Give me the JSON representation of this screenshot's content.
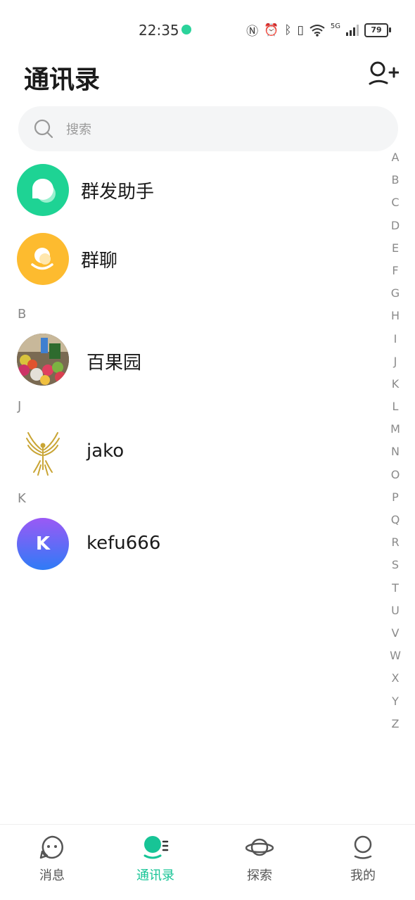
{
  "status_bar": {
    "time": "22:35",
    "battery": "79",
    "network": "5G"
  },
  "header": {
    "title": "通讯录"
  },
  "search": {
    "placeholder": "搜索"
  },
  "functions": [
    {
      "label": "群发助手",
      "color": "#1ed394",
      "icon": "chat-bubble-icon"
    },
    {
      "label": "群聊",
      "color": "#fdbb2f",
      "icon": "group-icon"
    }
  ],
  "sections": [
    {
      "letter": "B",
      "contacts": [
        {
          "name": "百果园",
          "avatar": "fruit-store-photo"
        }
      ]
    },
    {
      "letter": "J",
      "contacts": [
        {
          "name": "jako",
          "avatar": "golden-eagle-logo"
        }
      ]
    },
    {
      "letter": "K",
      "contacts": [
        {
          "name": "kefu666",
          "avatar_letter": "K"
        }
      ]
    }
  ],
  "alpha_index": [
    "A",
    "B",
    "C",
    "D",
    "E",
    "F",
    "G",
    "H",
    "I",
    "J",
    "K",
    "L",
    "M",
    "N",
    "O",
    "P",
    "Q",
    "R",
    "S",
    "T",
    "U",
    "V",
    "W",
    "X",
    "Y",
    "Z"
  ],
  "tabs": [
    {
      "label": "消息",
      "icon": "message-icon",
      "active": false
    },
    {
      "label": "通讯录",
      "icon": "contacts-icon",
      "active": true
    },
    {
      "label": "探索",
      "icon": "planet-icon",
      "active": false
    },
    {
      "label": "我的",
      "icon": "profile-icon",
      "active": false
    }
  ],
  "colors": {
    "accent": "#17c496",
    "group_send": "#1ed394",
    "group_chat": "#fdbb2f",
    "k_avatar_top": "#9b59f5",
    "k_avatar_bottom": "#2f7bf6"
  }
}
